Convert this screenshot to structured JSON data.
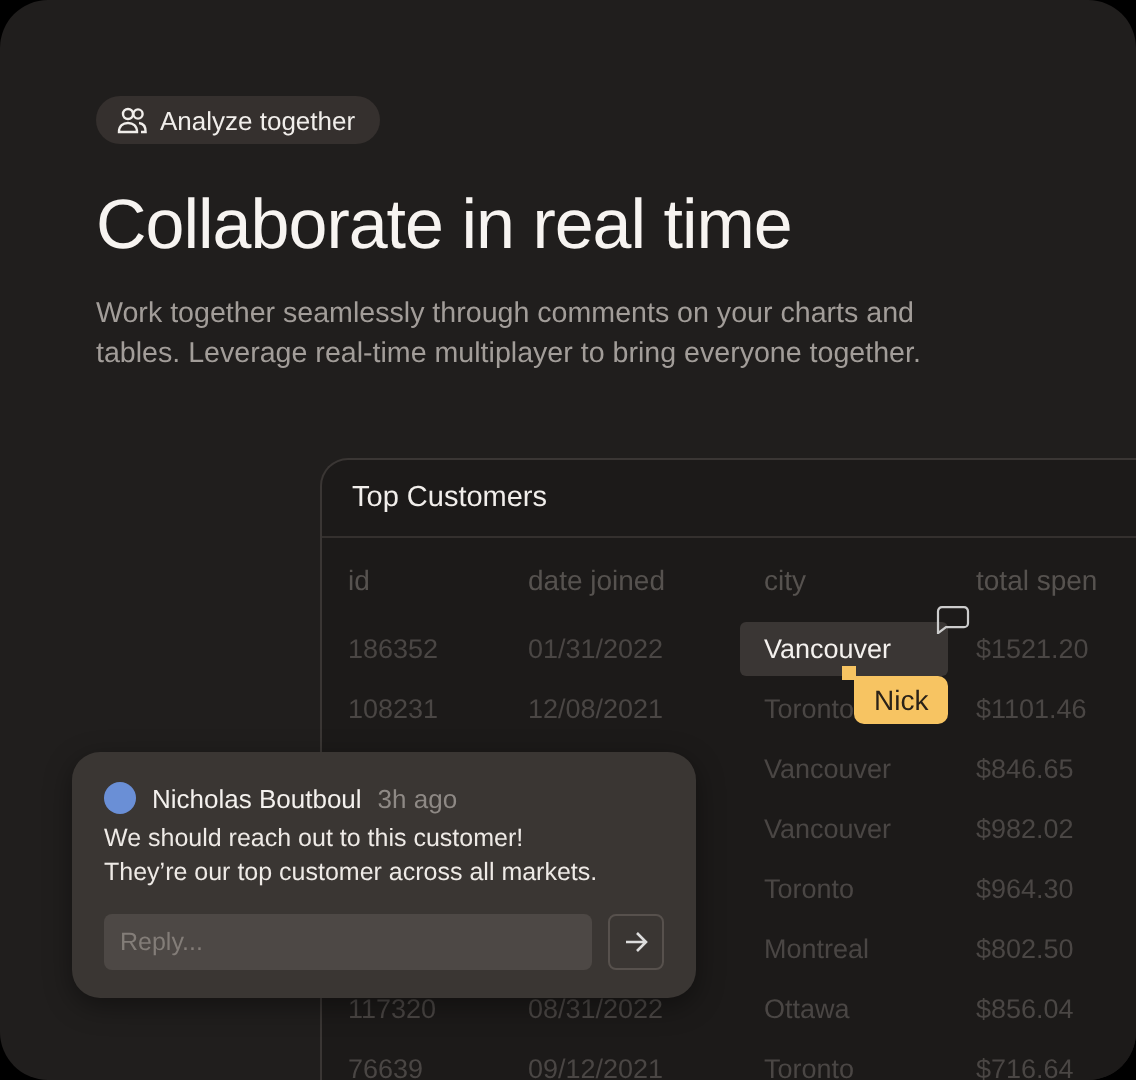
{
  "badge": {
    "label": "Analyze together"
  },
  "heading": "Collaborate in real time",
  "description": "Work together seamlessly through comments on your charts and tables. Leverage real-time multiplayer to bring everyone together.",
  "table": {
    "title": "Top Customers",
    "columns": [
      "id",
      "date joined",
      "city",
      "total spen"
    ],
    "rows": [
      {
        "cells": [
          "186352",
          "01/31/2022",
          "Vancouver",
          "$1521.20"
        ],
        "selected": true
      },
      {
        "cells": [
          "108231",
          "12/08/2021",
          "Toronto",
          "$1101.46"
        ],
        "selected": false
      },
      {
        "cells": [
          null,
          null,
          "Vancouver",
          "$846.65"
        ],
        "selected": false
      },
      {
        "cells": [
          null,
          null,
          "Vancouver",
          "$982.02"
        ],
        "selected": false
      },
      {
        "cells": [
          null,
          null,
          "Toronto",
          "$964.30"
        ],
        "selected": false
      },
      {
        "cells": [
          null,
          null,
          "Montreal",
          "$802.50"
        ],
        "selected": false
      },
      {
        "cells": [
          "117320",
          "08/31/2022",
          "Ottawa",
          "$856.04"
        ],
        "selected": false
      },
      {
        "cells": [
          "76639",
          "09/12/2021",
          "Toronto",
          "$716.64"
        ],
        "selected": false
      }
    ]
  },
  "cursor": {
    "name": "Nick",
    "color": "#f7c462"
  },
  "comment": {
    "author": "Nicholas Boutboul",
    "time": "3h ago",
    "message": "We should reach out to this customer!\nThey’re our top customer across all markets.",
    "reply_placeholder": "Reply..."
  }
}
